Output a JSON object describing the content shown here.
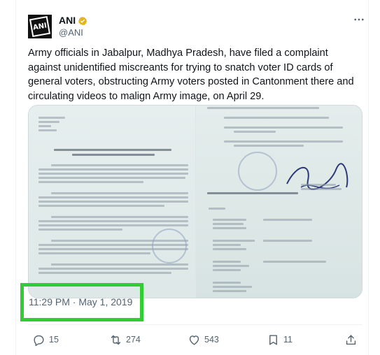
{
  "tweet": {
    "author": {
      "display_name": "ANI",
      "handle": "@ANI",
      "verified": true,
      "avatar_text": "ANI",
      "avatar_bg": "#111111"
    },
    "text": "Army officials in Jabalpur, Madhya Pradesh, have filed a complaint against unidentified miscreants for trying to snatch voter ID cards of general voters, obstructing Army voters posted in Cantonment there and circulating videos to malign Army image, on April 29.",
    "timestamp": "11:29 PM · May 1, 2019",
    "highlight_color": "#32cd32",
    "stats": {
      "replies": "15",
      "retweets": "274",
      "likes": "543",
      "bookmarks": "11"
    },
    "icons": {
      "reply": "reply-icon",
      "retweet": "retweet-icon",
      "like": "heart-icon",
      "bookmark": "bookmark-icon",
      "share": "share-icon",
      "more": "more-icon",
      "verified": "verified-badge-icon"
    }
  }
}
